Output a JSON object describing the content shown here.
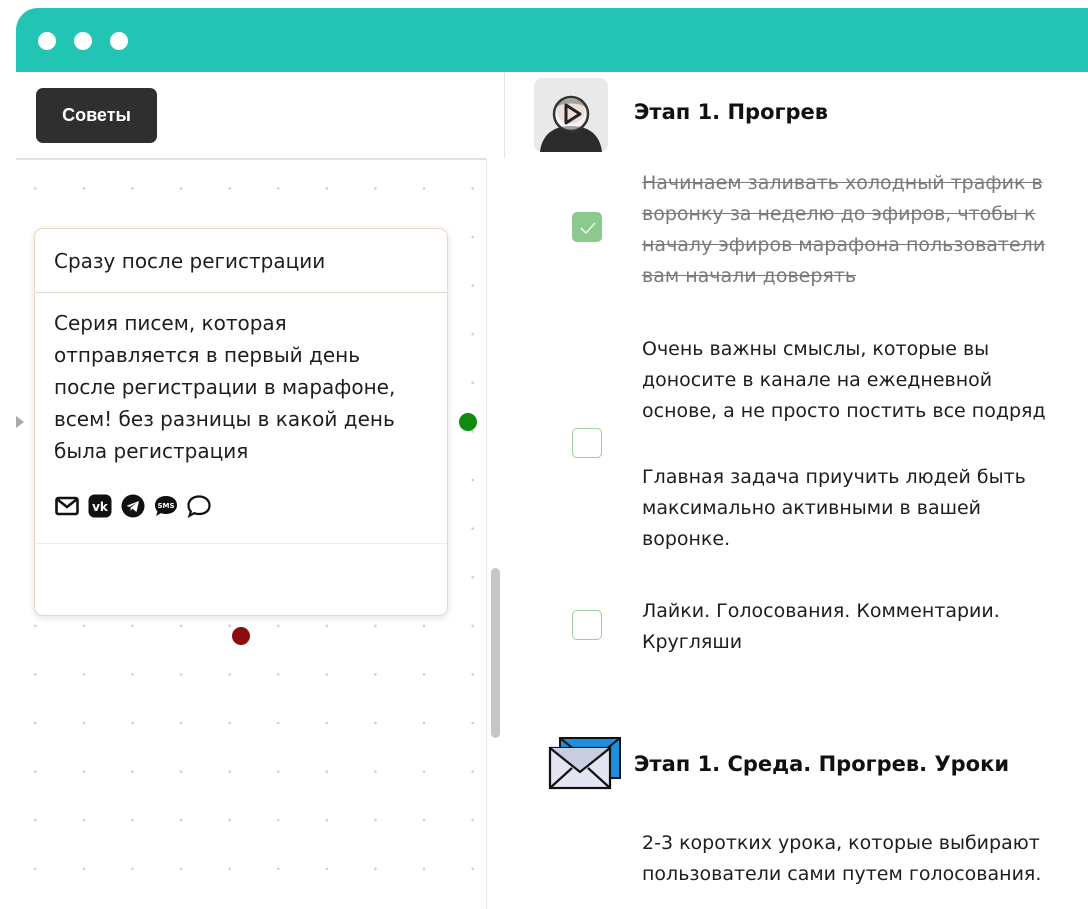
{
  "window": {
    "accent_color": "#22c4b3"
  },
  "toolbar": {
    "tips_label": "Советы"
  },
  "card": {
    "title": "Сразу после регистрации",
    "body_lines": [
      "Серия писем, которая",
      "отправляется в первый день",
      "после регистрации в марафоне,",
      "всем! без разницы в какой день",
      "была регистрация"
    ],
    "channel_icons": [
      "email-icon",
      "vk-icon",
      "telegram-icon",
      "sms-icon",
      "chat-bubble-icon"
    ]
  },
  "checklist": {
    "stage1": {
      "title": "Этап 1. Прогрев",
      "icon": "video-play-icon",
      "tasks": [
        {
          "checked": true,
          "lines": [
            "Начинаем заливать холодный трафик в",
            "воронку за неделю до эфиров, чтобы к",
            "началу эфиров марафона пользователи",
            "вам начали доверять"
          ]
        },
        {
          "checked": false,
          "lines": [
            "Очень важны смыслы, которые вы",
            "доносите в канале на ежедневной",
            "основе, а не просто постить все подряд"
          ],
          "lines2": [
            "Главная задача приучить людей быть",
            "максимально активными в вашей",
            "воронке."
          ]
        },
        {
          "checked": false,
          "lines": [
            "Лайки. Голосования. Комментарии.",
            "Кругляши"
          ]
        }
      ]
    },
    "stage2": {
      "title": "Этап 1. Среда. Прогрев. Уроки",
      "icon": "envelope-icon",
      "lines": [
        "2-3 коротких урока, которые выбирают",
        "пользователи сами путем голосования."
      ]
    }
  },
  "colors": {
    "port_green": "#118a11",
    "port_red": "#8b0d0d",
    "checkbox_green": "#8cc98c"
  }
}
